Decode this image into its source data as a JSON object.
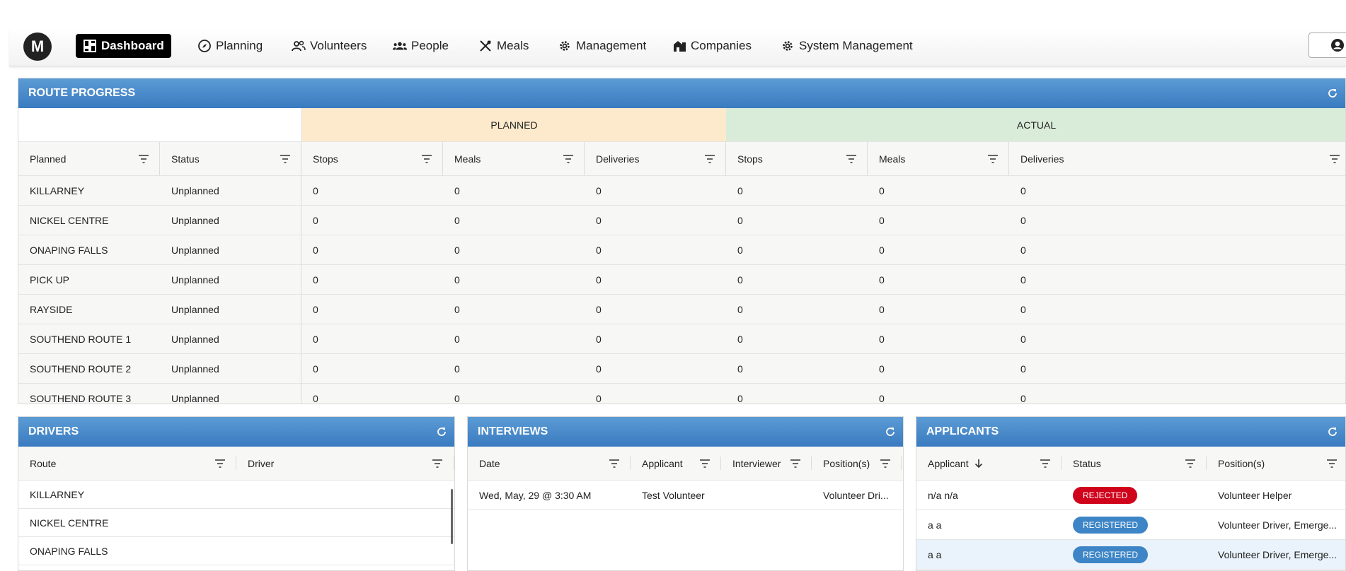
{
  "nav": {
    "logo": "M",
    "items": [
      "Dashboard",
      "Planning",
      "Volunteers",
      "People",
      "Meals",
      "Management",
      "Companies",
      "System Management"
    ]
  },
  "route_progress": {
    "title": "ROUTE PROGRESS",
    "group_planned": "PLANNED",
    "group_actual": "ACTUAL",
    "columns": [
      "Planned",
      "Status",
      "Stops",
      "Meals",
      "Deliveries",
      "Stops",
      "Meals",
      "Deliveries"
    ],
    "rows": [
      [
        "KILLARNEY",
        "Unplanned",
        "0",
        "0",
        "0",
        "0",
        "0",
        "0"
      ],
      [
        "NICKEL CENTRE",
        "Unplanned",
        "0",
        "0",
        "0",
        "0",
        "0",
        "0"
      ],
      [
        "ONAPING FALLS",
        "Unplanned",
        "0",
        "0",
        "0",
        "0",
        "0",
        "0"
      ],
      [
        "PICK UP",
        "Unplanned",
        "0",
        "0",
        "0",
        "0",
        "0",
        "0"
      ],
      [
        "RAYSIDE",
        "Unplanned",
        "0",
        "0",
        "0",
        "0",
        "0",
        "0"
      ],
      [
        "SOUTHEND ROUTE 1",
        "Unplanned",
        "0",
        "0",
        "0",
        "0",
        "0",
        "0"
      ],
      [
        "SOUTHEND ROUTE 2",
        "Unplanned",
        "0",
        "0",
        "0",
        "0",
        "0",
        "0"
      ],
      [
        "SOUTHEND ROUTE 3",
        "Unplanned",
        "0",
        "0",
        "0",
        "0",
        "0",
        "0"
      ]
    ]
  },
  "drivers": {
    "title": "DRIVERS",
    "columns": [
      "Route",
      "Driver"
    ],
    "rows": [
      [
        "KILLARNEY",
        ""
      ],
      [
        "NICKEL CENTRE",
        ""
      ],
      [
        "ONAPING FALLS",
        ""
      ]
    ]
  },
  "interviews": {
    "title": "INTERVIEWS",
    "columns": [
      "Date",
      "Applicant",
      "Interviewer",
      "Position(s)"
    ],
    "rows": [
      [
        "Wed, May, 29 @ 3:30 AM",
        "Test Volunteer",
        "",
        "Volunteer Dri..."
      ]
    ]
  },
  "applicants": {
    "title": "APPLICANTS",
    "columns": [
      "Applicant",
      "Status",
      "Position(s)"
    ],
    "rows": [
      {
        "applicant": "n/a n/a",
        "status": "REJECTED",
        "status_color": "#d0021b",
        "positions": "Volunteer Helper"
      },
      {
        "applicant": "a a",
        "status": "REGISTERED",
        "status_color": "#3d85c6",
        "positions": "Volunteer Driver, Emerge..."
      },
      {
        "applicant": "a a",
        "status": "REGISTERED",
        "status_color": "#3d85c6",
        "positions": "Volunteer Driver, Emerge..."
      }
    ]
  },
  "colors": {
    "header_blue": "#4a8ac9",
    "planned_bg": "#fde9cc",
    "actual_bg": "#d9ecd9"
  }
}
